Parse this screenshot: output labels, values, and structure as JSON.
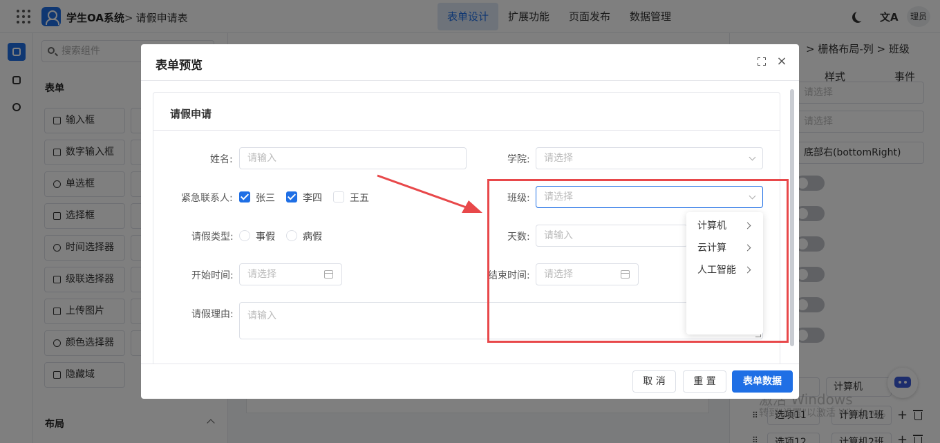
{
  "header": {
    "app_title": "学生OA系统",
    "breadcrumb_sep": ">",
    "breadcrumb": "请假申请表",
    "nav": [
      "表单设计",
      "扩展功能",
      "页面发布",
      "数据管理"
    ],
    "active_nav_index": 0,
    "translate_icon": "translate-icon",
    "avatar_text": "理员"
  },
  "components_panel": {
    "search_placeholder": "搜索组件",
    "form_section": "表单",
    "items": [
      "输入框",
      "数字输入框",
      "单选框",
      "选择框",
      "时间选择器",
      "级联选择器",
      "上传图片",
      "颜色选择器",
      "隐藏域"
    ],
    "layout_section": "布局"
  },
  "props_panel": {
    "breadcrumb": "> 栅格布局-列 > 班级",
    "tabs": [
      "样式",
      "事件"
    ],
    "fields": [
      "请选择",
      "请选择",
      "底部右(bottomRight)"
    ],
    "options": [
      {
        "label": "",
        "value": "计算机"
      },
      {
        "label": "选项11",
        "value": "计算机1班"
      },
      {
        "label": "选项12",
        "value": "计算机2班"
      }
    ],
    "watermark": "激活 Windows",
    "watermark_sub": "转到\"设置\"以激活 Windows。"
  },
  "modal": {
    "title": "表单预览",
    "card_title": "请假申请",
    "fields": {
      "name_label": "姓名:",
      "name_placeholder": "请输入",
      "college_label": "学院:",
      "college_placeholder": "请选择",
      "contact_label": "紧急联系人:",
      "contacts": [
        {
          "label": "张三",
          "checked": true
        },
        {
          "label": "李四",
          "checked": true
        },
        {
          "label": "王五",
          "checked": false
        }
      ],
      "class_label": "班级:",
      "class_placeholder": "请选择",
      "leave_type_label": "请假类型:",
      "leave_types": [
        "事假",
        "病假"
      ],
      "days_label": "天数:",
      "days_placeholder": "请输入",
      "start_label": "开始时间:",
      "start_placeholder": "请选择",
      "end_label": "结束时间:",
      "end_placeholder": "请选择",
      "reason_label": "请假理由:",
      "reason_placeholder": "请输入"
    },
    "cascader_options": [
      "计算机",
      "云计算",
      "人工智能"
    ],
    "buttons": {
      "cancel": "取 消",
      "reset": "重 置",
      "submit": "表单数据"
    }
  },
  "colors": {
    "primary": "#1f6fe5",
    "annotation": "#e8484a"
  }
}
